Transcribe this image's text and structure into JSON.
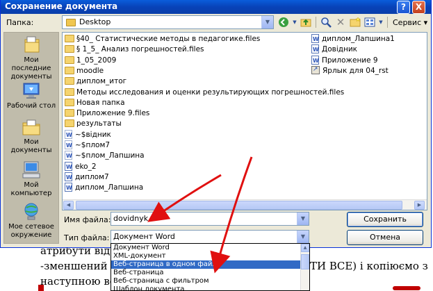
{
  "document": {
    "line1": "атрибути від",
    "line2": "-зменшений р",
    "line2_right": "ТИ ВСЕ) і копіюємо з",
    "line3": "наступною вс"
  },
  "dialog": {
    "title": "Сохранение документа",
    "help_label": "?",
    "close_label": "X",
    "lookin_label": "Папка:",
    "lookin_value": "Desktop",
    "service_label": "Сервис ▾"
  },
  "places": [
    {
      "label": "Мои последние документы",
      "icon": "recent-docs-icon"
    },
    {
      "label": "Рабочий стол",
      "icon": "desktop-icon"
    },
    {
      "label": "Мои документы",
      "icon": "my-documents-icon"
    },
    {
      "label": "Мой компьютер",
      "icon": "my-computer-icon"
    },
    {
      "label": "Мое сетевое окружение",
      "icon": "network-icon"
    }
  ],
  "files_col1": [
    {
      "name": "§40_ Статистические методы в педагогике.files",
      "type": "folder"
    },
    {
      "name": "§ 1_5_ Анализ погрешностей.files",
      "type": "folder"
    },
    {
      "name": "1_05_2009",
      "type": "folder"
    },
    {
      "name": "moodle",
      "type": "folder"
    },
    {
      "name": "диплом_итог",
      "type": "folder"
    },
    {
      "name": "Методы исследования и оценки результирующих погрешностей.files",
      "type": "folder"
    },
    {
      "name": "Новая папка",
      "type": "folder"
    },
    {
      "name": "Приложение 9.files",
      "type": "folder"
    },
    {
      "name": "результаты",
      "type": "folder"
    },
    {
      "name": "~$відник",
      "type": "ghost"
    },
    {
      "name": "~$плом7",
      "type": "ghost"
    },
    {
      "name": "~$плом_Лапшина",
      "type": "ghost"
    },
    {
      "name": "eko_2",
      "type": "doc"
    },
    {
      "name": "диплом7",
      "type": "doc"
    },
    {
      "name": "диплом_Лапшина",
      "type": "doc"
    }
  ],
  "files_col2": [
    {
      "name": "диплом_Лапшина1",
      "type": "doc"
    },
    {
      "name": "Довідник",
      "type": "doc"
    },
    {
      "name": "Приложение 9",
      "type": "doc"
    },
    {
      "name": "Ярлык для 04_rst",
      "type": "link"
    }
  ],
  "form": {
    "filename_label": "Имя файла:",
    "filename_value": "dovidnyk",
    "filetype_label": "Тип файла:",
    "filetype_value": "Документ Word",
    "save_label": "Сохранить",
    "cancel_label": "Отмена"
  },
  "filetype_options": [
    "Документ Word",
    "XML-документ",
    "Веб-страница в одном файле",
    "Веб-страница",
    "Веб-страница с фильтром",
    "Шаблон документа"
  ],
  "selected_option_index": 2,
  "colors": {
    "titlebar": "#0842b8",
    "dialog_bg": "#ece9d8",
    "selection": "#316ac5",
    "annotation_arrow": "#e01010"
  }
}
